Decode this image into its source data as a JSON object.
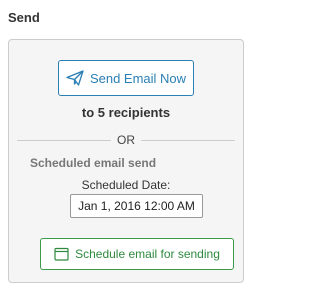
{
  "section": {
    "title": "Send"
  },
  "send_now": {
    "label": "Send Email Now",
    "icon": "paper-plane-icon"
  },
  "recipients_text": "to 5 recipients",
  "separator_text": "OR",
  "scheduled": {
    "title": "Scheduled email send",
    "date_label": "Scheduled Date:",
    "date_value": "Jan 1, 2016 12:00 AM",
    "button_label": "Schedule email for sending",
    "button_icon": "calendar-icon"
  },
  "colors": {
    "send_accent": "#2a7fb4",
    "schedule_accent": "#2e8a3e",
    "panel_bg": "#f5f5f5"
  }
}
